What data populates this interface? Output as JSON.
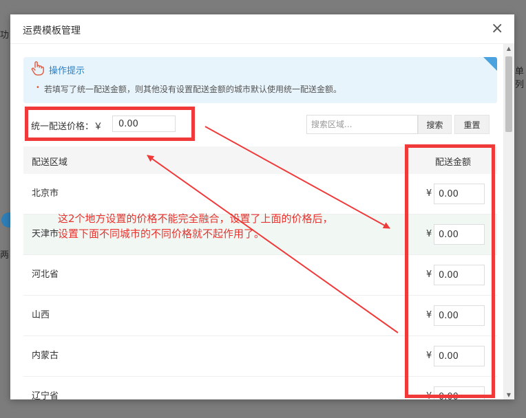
{
  "background": {
    "left_fragment_1": "功",
    "left_fragment_2": "两",
    "right_fragment": "单列"
  },
  "modal": {
    "title": "运费模板管理",
    "close_glyph": "×"
  },
  "tip": {
    "title": "操作提示",
    "bullet": "•",
    "text": "若填写了统一配送金额，则其他没有设置配送金额的城市默认使用统一配送金额。"
  },
  "unified_price": {
    "label": "统一配送价格：￥",
    "value": "0.00"
  },
  "search": {
    "placeholder": "搜索区域...",
    "search_label": "搜索",
    "reset_label": "重置"
  },
  "table": {
    "col_region": "配送区域",
    "col_amount": "配送金额",
    "currency": "¥",
    "rows": [
      {
        "name": "北京市",
        "value": "0.00"
      },
      {
        "name": "天津市",
        "value": "0.00"
      },
      {
        "name": "河北省",
        "value": "0.00"
      },
      {
        "name": "山西",
        "value": "0.00"
      },
      {
        "name": "内蒙古",
        "value": "0.00"
      },
      {
        "name": "辽宁省",
        "value": "0.00"
      }
    ]
  },
  "annotation": {
    "line1": "这2个地方设置的价格不能完全融合，设置了上面的价格后，",
    "line2": "设置下面不同城市的不同价格就不起作用了。",
    "color": "#f03a3a"
  },
  "colors": {
    "tip_bg": "#e8f4fb",
    "tip_title": "#2a7fc6",
    "highlight_row": "#f1f8f4",
    "overlay": "#7c7c7c"
  }
}
